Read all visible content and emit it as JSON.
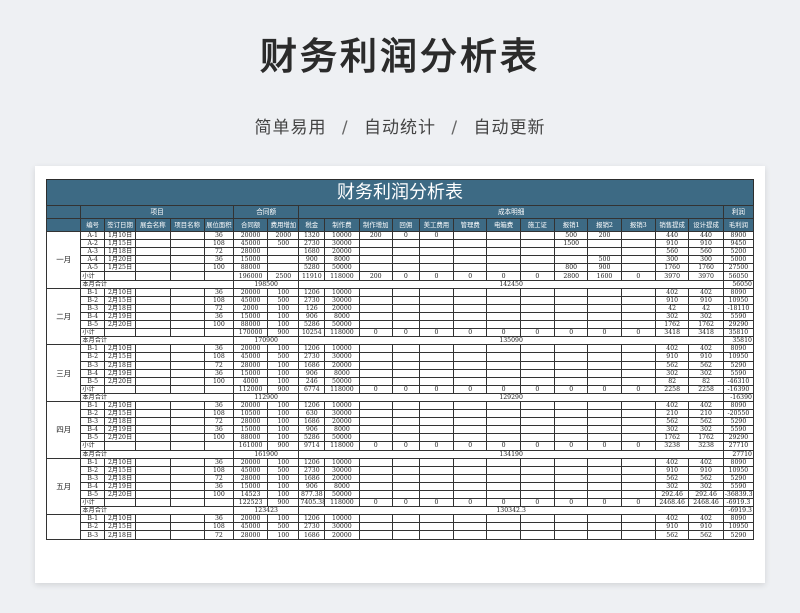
{
  "page": {
    "title": "财务利润分析表",
    "subtitle_parts": [
      "简单易用",
      "自动统计",
      "自动更新"
    ],
    "separator": "/"
  },
  "sheet": {
    "banner": "财务利润分析表",
    "group_headers": {
      "project": "项目",
      "contract": "合同额",
      "cost": "成本明细",
      "profit": "利润"
    },
    "columns": [
      "编号",
      "签订日期",
      "展会名称",
      "项目名称",
      "展位面积",
      "合同额",
      "费用增加",
      "税金",
      "制作费",
      "制作增加",
      "回佣",
      "美工费用",
      "管理费",
      "电箱费",
      "施工证",
      "报销1",
      "报销2",
      "报销3",
      "销售提成",
      "设计提成",
      "毛利润"
    ],
    "accent_color": "#3d6a84",
    "months": [
      {
        "name": "一月",
        "rows": [
          [
            "A-1",
            "1月10日",
            "",
            "",
            "36",
            "20000",
            "2000",
            "1320",
            "10000",
            "200",
            "0",
            "0",
            "",
            "",
            "",
            "500",
            "200",
            "",
            "440",
            "440",
            "8900"
          ],
          [
            "A-2",
            "1月15日",
            "",
            "",
            "108",
            "45000",
            "500",
            "2730",
            "30000",
            "",
            "",
            "",
            "",
            "",
            "",
            "1500",
            "",
            "",
            "910",
            "910",
            "9450"
          ],
          [
            "A-3",
            "1月18日",
            "",
            "",
            "72",
            "28000",
            "",
            "1680",
            "20000",
            "",
            "",
            "",
            "",
            "",
            "",
            "",
            "",
            "",
            "560",
            "560",
            "5200"
          ],
          [
            "A-4",
            "1月20日",
            "",
            "",
            "36",
            "15000",
            "",
            "900",
            "8000",
            "",
            "",
            "",
            "",
            "",
            "",
            "",
            "500",
            "",
            "300",
            "300",
            "5000"
          ],
          [
            "A-5",
            "1月25日",
            "",
            "",
            "100",
            "88000",
            "",
            "5280",
            "50000",
            "",
            "",
            "",
            "",
            "",
            "",
            "800",
            "900",
            "",
            "1760",
            "1760",
            "27500"
          ]
        ],
        "subtotal": [
          "小计",
          "",
          "",
          "",
          "",
          "196000",
          "2500",
          "11910",
          "118000",
          "200",
          "0",
          "0",
          "0",
          "0",
          "0",
          "2800",
          "1600",
          "0",
          "3970",
          "3970",
          "56050"
        ],
        "total": {
          "label": "本月合计",
          "revenue": "198500",
          "cost": "142450",
          "profit": "56050"
        }
      },
      {
        "name": "二月",
        "rows": [
          [
            "B-1",
            "2月10日",
            "",
            "",
            "36",
            "20000",
            "100",
            "1206",
            "10000",
            "",
            "",
            "",
            "",
            "",
            "",
            "",
            "",
            "",
            "402",
            "402",
            "8090"
          ],
          [
            "B-2",
            "2月15日",
            "",
            "",
            "108",
            "45000",
            "500",
            "2730",
            "30000",
            "",
            "",
            "",
            "",
            "",
            "",
            "",
            "",
            "",
            "910",
            "910",
            "10950"
          ],
          [
            "B-3",
            "2月18日",
            "",
            "",
            "72",
            "2000",
            "100",
            "126",
            "20000",
            "",
            "",
            "",
            "",
            "",
            "",
            "",
            "",
            "",
            "42",
            "42",
            "-18110"
          ],
          [
            "B-4",
            "2月19日",
            "",
            "",
            "36",
            "15000",
            "100",
            "906",
            "8000",
            "",
            "",
            "",
            "",
            "",
            "",
            "",
            "",
            "",
            "302",
            "302",
            "5590"
          ],
          [
            "B-5",
            "2月20日",
            "",
            "",
            "100",
            "88000",
            "100",
            "5286",
            "50000",
            "",
            "",
            "",
            "",
            "",
            "",
            "",
            "",
            "",
            "1762",
            "1762",
            "29290"
          ]
        ],
        "subtotal": [
          "小计",
          "",
          "",
          "",
          "",
          "170000",
          "900",
          "10254",
          "118000",
          "0",
          "0",
          "0",
          "0",
          "0",
          "0",
          "0",
          "0",
          "0",
          "3418",
          "3418",
          "35810"
        ],
        "total": {
          "label": "本月合计",
          "revenue": "170900",
          "cost": "135090",
          "profit": "35810"
        }
      },
      {
        "name": "三月",
        "rows": [
          [
            "B-1",
            "2月10日",
            "",
            "",
            "36",
            "20000",
            "100",
            "1206",
            "10000",
            "",
            "",
            "",
            "",
            "",
            "",
            "",
            "",
            "",
            "402",
            "402",
            "8090"
          ],
          [
            "B-2",
            "2月15日",
            "",
            "",
            "108",
            "45000",
            "500",
            "2730",
            "30000",
            "",
            "",
            "",
            "",
            "",
            "",
            "",
            "",
            "",
            "910",
            "910",
            "10950"
          ],
          [
            "B-3",
            "2月18日",
            "",
            "",
            "72",
            "28000",
            "100",
            "1686",
            "20000",
            "",
            "",
            "",
            "",
            "",
            "",
            "",
            "",
            "",
            "562",
            "562",
            "5290"
          ],
          [
            "B-4",
            "2月19日",
            "",
            "",
            "36",
            "15000",
            "100",
            "906",
            "8000",
            "",
            "",
            "",
            "",
            "",
            "",
            "",
            "",
            "",
            "302",
            "302",
            "5590"
          ],
          [
            "B-5",
            "2月20日",
            "",
            "",
            "100",
            "4000",
            "100",
            "246",
            "50000",
            "",
            "",
            "",
            "",
            "",
            "",
            "",
            "",
            "",
            "82",
            "82",
            "-46310"
          ]
        ],
        "subtotal": [
          "小计",
          "",
          "",
          "",
          "",
          "112000",
          "900",
          "6774",
          "118000",
          "0",
          "0",
          "0",
          "0",
          "0",
          "0",
          "0",
          "0",
          "0",
          "2258",
          "2258",
          "-16390"
        ],
        "total": {
          "label": "本月合计",
          "revenue": "112900",
          "cost": "129290",
          "profit": "-16390"
        }
      },
      {
        "name": "四月",
        "rows": [
          [
            "B-1",
            "2月10日",
            "",
            "",
            "36",
            "20000",
            "100",
            "1206",
            "10000",
            "",
            "",
            "",
            "",
            "",
            "",
            "",
            "",
            "",
            "402",
            "402",
            "8090"
          ],
          [
            "B-2",
            "2月15日",
            "",
            "",
            "108",
            "10500",
            "100",
            "630",
            "30000",
            "",
            "",
            "",
            "",
            "",
            "",
            "",
            "",
            "",
            "210",
            "210",
            "-20550"
          ],
          [
            "B-3",
            "2月18日",
            "",
            "",
            "72",
            "28000",
            "100",
            "1686",
            "20000",
            "",
            "",
            "",
            "",
            "",
            "",
            "",
            "",
            "",
            "562",
            "562",
            "5290"
          ],
          [
            "B-4",
            "2月19日",
            "",
            "",
            "36",
            "15000",
            "100",
            "906",
            "8000",
            "",
            "",
            "",
            "",
            "",
            "",
            "",
            "",
            "",
            "302",
            "302",
            "5590"
          ],
          [
            "B-5",
            "2月20日",
            "",
            "",
            "100",
            "88000",
            "100",
            "5286",
            "50000",
            "",
            "",
            "",
            "",
            "",
            "",
            "",
            "",
            "",
            "1762",
            "1762",
            "29290"
          ]
        ],
        "subtotal": [
          "小计",
          "",
          "",
          "",
          "",
          "161000",
          "900",
          "9714",
          "118000",
          "0",
          "0",
          "0",
          "0",
          "0",
          "0",
          "0",
          "0",
          "0",
          "3238",
          "3238",
          "27710"
        ],
        "total": {
          "label": "本月合计",
          "revenue": "161900",
          "cost": "134190",
          "profit": "27710"
        }
      },
      {
        "name": "五月",
        "rows": [
          [
            "B-1",
            "2月10日",
            "",
            "",
            "36",
            "20000",
            "100",
            "1206",
            "10000",
            "",
            "",
            "",
            "",
            "",
            "",
            "",
            "",
            "",
            "402",
            "402",
            "8090"
          ],
          [
            "B-2",
            "2月15日",
            "",
            "",
            "108",
            "45000",
            "500",
            "2730",
            "30000",
            "",
            "",
            "",
            "",
            "",
            "",
            "",
            "",
            "",
            "910",
            "910",
            "10950"
          ],
          [
            "B-3",
            "2月18日",
            "",
            "",
            "72",
            "28000",
            "100",
            "1686",
            "20000",
            "",
            "",
            "",
            "",
            "",
            "",
            "",
            "",
            "",
            "562",
            "562",
            "5290"
          ],
          [
            "B-4",
            "2月19日",
            "",
            "",
            "36",
            "15000",
            "100",
            "906",
            "8000",
            "",
            "",
            "",
            "",
            "",
            "",
            "",
            "",
            "",
            "302",
            "302",
            "5590"
          ],
          [
            "B-5",
            "2月20日",
            "",
            "",
            "100",
            "14523",
            "100",
            "877.38",
            "50000",
            "",
            "",
            "",
            "",
            "",
            "",
            "",
            "",
            "",
            "292.46",
            "292.46",
            "-36839.3"
          ]
        ],
        "subtotal": [
          "小计",
          "",
          "",
          "",
          "",
          "122523",
          "900",
          "7405.38",
          "118000",
          "0",
          "0",
          "0",
          "0",
          "0",
          "0",
          "0",
          "0",
          "0",
          "2468.46",
          "2468.46",
          "-6919.3"
        ],
        "total": {
          "label": "本月合计",
          "revenue": "123423",
          "cost": "130342.3",
          "profit": "-6919.3"
        }
      },
      {
        "name": "",
        "rows": [
          [
            "B-1",
            "2月10日",
            "",
            "",
            "36",
            "20000",
            "100",
            "1206",
            "10000",
            "",
            "",
            "",
            "",
            "",
            "",
            "",
            "",
            "",
            "402",
            "402",
            "8090"
          ],
          [
            "B-2",
            "2月15日",
            "",
            "",
            "108",
            "45000",
            "500",
            "2730",
            "30000",
            "",
            "",
            "",
            "",
            "",
            "",
            "",
            "",
            "",
            "910",
            "910",
            "10950"
          ],
          [
            "B-3",
            "2月18日",
            "",
            "",
            "72",
            "28000",
            "100",
            "1686",
            "20000",
            "",
            "",
            "",
            "",
            "",
            "",
            "",
            "",
            "",
            "562",
            "562",
            "5290"
          ]
        ],
        "subtotal": null,
        "total": null
      }
    ]
  }
}
